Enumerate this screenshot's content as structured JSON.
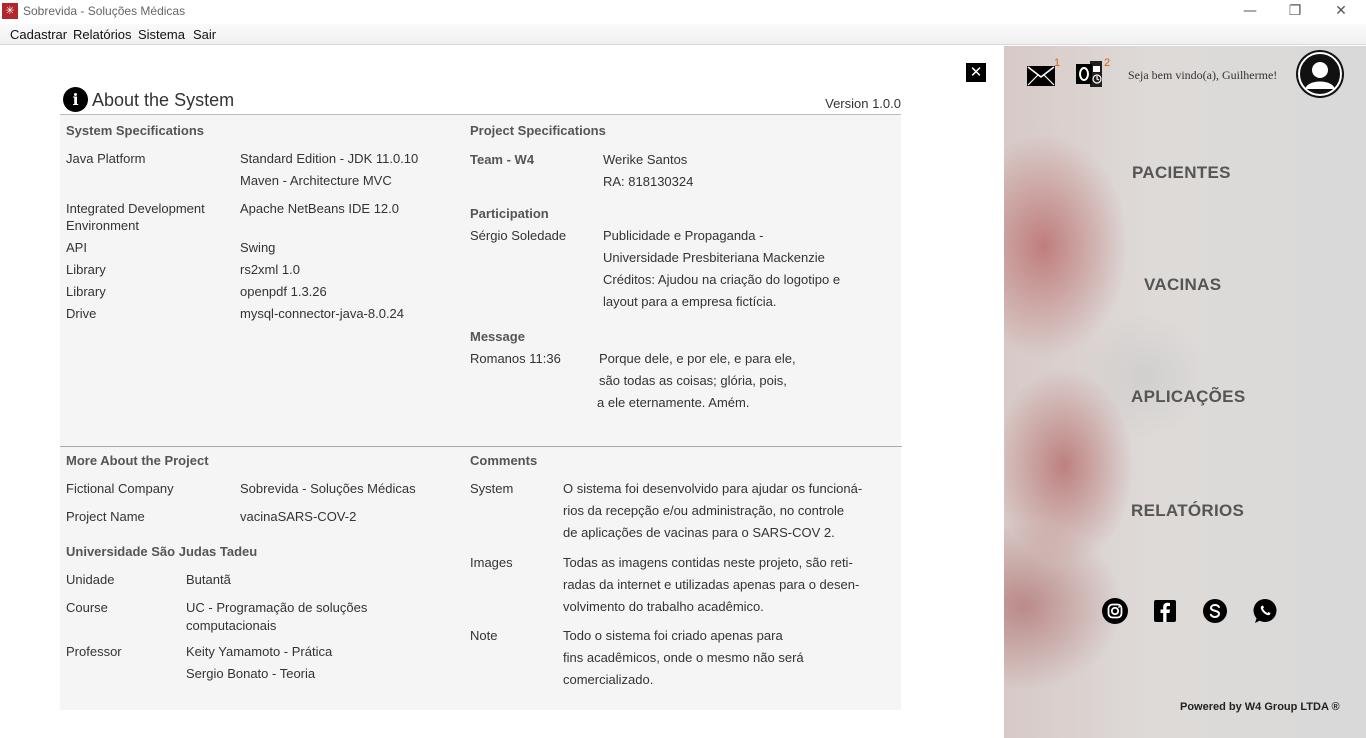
{
  "window": {
    "title": "Sobrevida - Soluções Médicas"
  },
  "menu": [
    "Cadastrar",
    "Relatórios",
    "Sistema",
    "Sair"
  ],
  "about": {
    "title": "About the System",
    "version": "Version 1.0.0",
    "system_specs": {
      "heading": "System Specifications",
      "rows": [
        {
          "label": "Java Platform",
          "values": [
            "Standard Edition - JDK 11.0.10",
            "Maven - Architecture MVC"
          ]
        },
        {
          "label": "Integrated Development",
          "label2": "Environment",
          "values": [
            "Apache NetBeans IDE 12.0"
          ]
        },
        {
          "label": "API",
          "values": [
            "Swing"
          ]
        },
        {
          "label": "Library",
          "values": [
            "rs2xml 1.0"
          ]
        },
        {
          "label": "Library",
          "values": [
            "openpdf 1.3.26"
          ]
        },
        {
          "label": "Drive",
          "values": [
            "mysql-connector-java-8.0.24"
          ]
        }
      ]
    },
    "project_specs": {
      "heading": "Project Specifications",
      "team_label": "Team - W4",
      "team_values": [
        "Werike Santos",
        "RA: 818130324"
      ],
      "participation_heading": "Participation",
      "participant": "Sérgio Soledade",
      "participation_values": [
        "Publicidade e Propaganda -",
        "Universidade Presbiteriana Mackenzie",
        "Créditos: Ajudou na criação do logotipo e",
        "layout para a empresa fictícia."
      ],
      "message_heading": "Message",
      "message_label": "Romanos 11:36",
      "message_values": [
        "Porque dele, e por ele, e para ele,",
        "são todas as coisas; glória, pois,",
        "a ele eternamente. Amém."
      ]
    },
    "more": {
      "heading": "More About the Project",
      "company_label": "Fictional Company",
      "company_value": "Sobrevida - Soluções Médicas",
      "project_label": "Project Name",
      "project_value": "vacinaSARS-COV-2",
      "uni_heading": "Universidade São Judas Tadeu",
      "unit_label": "Unidade",
      "unit_value": "Butantã",
      "course_label": "Course",
      "course_values": [
        "UC - Programação de soluções",
        "computacionais"
      ],
      "professor_label": "Professor",
      "professor_values": [
        "Keity Yamamoto - Prática",
        "Sergio Bonato - Teoria"
      ]
    },
    "comments": {
      "heading": "Comments",
      "system_label": "System",
      "system_values": [
        "O sistema foi desenvolvido para ajudar os funcioná-",
        "rios da recepção e/ou administração, no controle",
        "de aplicações de vacinas para o SARS-COV 2."
      ],
      "images_label": "Images",
      "images_values": [
        "Todas as imagens contidas neste projeto, são reti-",
        "radas da internet e utilizadas apenas para o desen-",
        "volvimento do trabalho acadêmico."
      ],
      "note_label": "Note",
      "note_values": [
        "Todo o sistema foi criado apenas para",
        "fins acadêmicos, onde o mesmo não será",
        "comercializado."
      ]
    }
  },
  "sidebar": {
    "welcome": "Seja bem vindo(a), Guilherme!",
    "mail_badge": "1",
    "outlook_badge": "2",
    "nav": [
      "PACIENTES",
      "VACINAS",
      "APLICAÇÕES",
      "RELATÓRIOS"
    ],
    "social_icons": [
      "instagram-icon",
      "facebook-icon",
      "skype-icon",
      "whatsapp-icon"
    ],
    "powered": "Powered by W4 Group LTDA ®"
  }
}
